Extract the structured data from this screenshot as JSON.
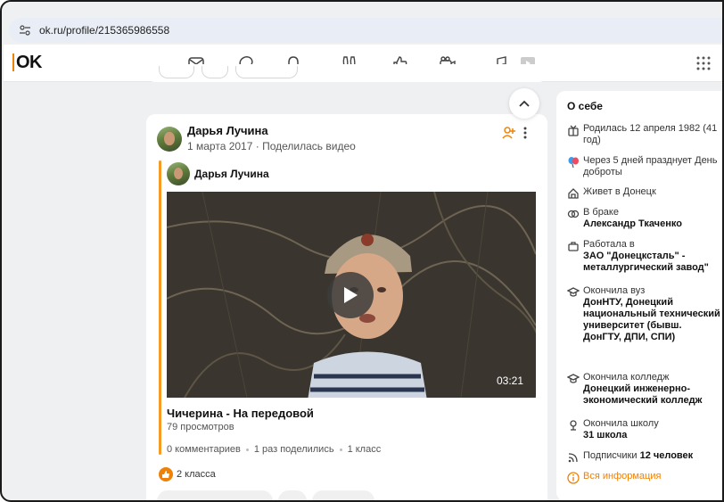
{
  "browser": {
    "url": "ok.ru/profile/215365986558"
  },
  "app": {
    "logo_text": "OK"
  },
  "nav": {
    "icons": [
      "mail-icon",
      "chat-icon",
      "bell-icon",
      "guests-icon",
      "likes-icon",
      "video-icon",
      "music-icon",
      "games-icon",
      "apps-grid-icon"
    ]
  },
  "post": {
    "author": "Дарья Лучина",
    "date": "1 марта 2017",
    "action": "Поделилась видео",
    "meta_separator": "·",
    "inner_author": "Дарья Лучина",
    "video_title": "Чичерина - На передовой",
    "video_views": "79 просмотров",
    "video_duration": "03:21",
    "stats": [
      "0 комментариев",
      "1 раз поделились",
      "1 класс"
    ],
    "likes": "2 класса"
  },
  "about": {
    "title": "О себе",
    "rows": [
      {
        "icon": "gift-icon",
        "text": "Родилась 12 апреля 1982 (41 год)",
        "bold": ""
      },
      {
        "icon": "balloons-icon",
        "text": "Через 5 дней празднует День доброты",
        "bold": ""
      },
      {
        "icon": "home-icon",
        "text": "Живет в Донецк",
        "bold": ""
      },
      {
        "icon": "rings-icon",
        "text": "В браке",
        "bold": "Александр Ткаченко"
      },
      {
        "icon": "work-icon",
        "text": "Работала в",
        "bold": "ЗАО \"Донецксталь\" - металлургический завод\""
      },
      {
        "icon": "graduation-icon",
        "text": "Окончила вуз",
        "bold": "ДонНТУ, Донецкий национальный технический университет (бывш. ДонГТУ, ДПИ, СПИ)"
      },
      {
        "icon": "graduation-icon",
        "text": "Окончила колледж",
        "bold": "Донецкий инженерно-экономический колледж"
      },
      {
        "icon": "school-icon",
        "text": "Окончила школу",
        "bold": "31 школа"
      },
      {
        "icon": "rss-icon",
        "text": "Подписчики",
        "bold": "12 человек"
      }
    ],
    "more_link": "Вся информация"
  },
  "colors": {
    "accent": "#ee8208",
    "repost_line": "#f59b23"
  }
}
